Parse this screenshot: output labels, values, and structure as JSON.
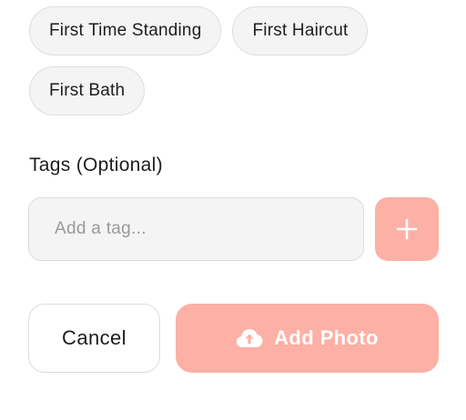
{
  "milestones": {
    "chips": [
      {
        "label": "First Time Standing"
      },
      {
        "label": "First Haircut"
      },
      {
        "label": "First Bath"
      }
    ]
  },
  "tags": {
    "label": "Tags (Optional)",
    "input_placeholder": "Add a tag...",
    "input_value": "",
    "add_button_icon": "plus-icon"
  },
  "actions": {
    "cancel_label": "Cancel",
    "add_photo_label": "Add Photo",
    "add_photo_icon": "cloud-upload-icon"
  },
  "colors": {
    "accent": "#fdb0a5",
    "chip_background": "#f4f4f4",
    "border": "#dcdcdc",
    "text": "#1d1d21",
    "placeholder": "#9a9a9a"
  }
}
